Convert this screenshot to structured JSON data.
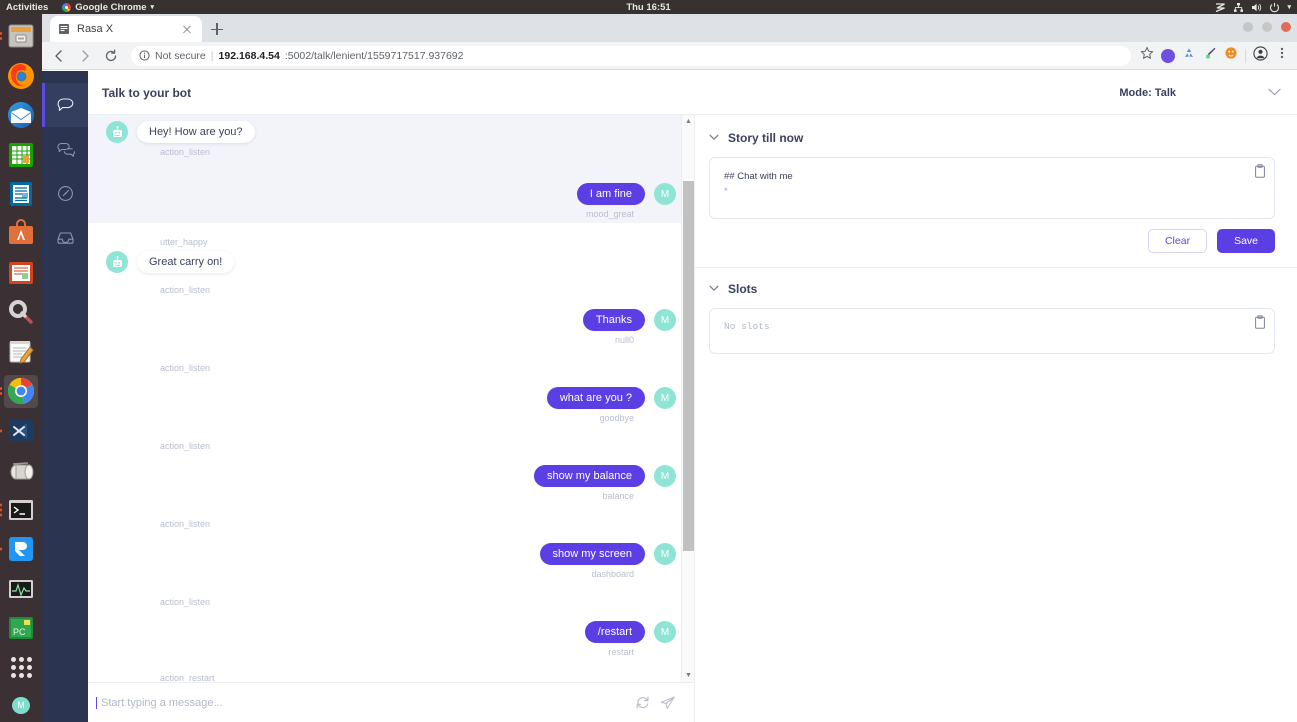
{
  "os": {
    "activities": "Activities",
    "app_menu": "Google Chrome",
    "clock": "Thu 16:51",
    "dock": [
      {
        "name": "files",
        "label": "Files"
      },
      {
        "name": "firefox",
        "label": "Firefox"
      },
      {
        "name": "thunderbird",
        "label": "Thunderbird"
      },
      {
        "name": "libreoffice-calc",
        "label": "LibreOffice Calc"
      },
      {
        "name": "libreoffice-writer",
        "label": "LibreOffice Writer"
      },
      {
        "name": "ubuntu-software",
        "label": "Ubuntu Software"
      },
      {
        "name": "libreoffice-impress",
        "label": "LibreOffice Impress"
      },
      {
        "name": "settings-tools",
        "label": "System Tools"
      },
      {
        "name": "text-editor",
        "label": "Text Editor"
      },
      {
        "name": "google-chrome",
        "label": "Google Chrome"
      },
      {
        "name": "vs-code",
        "label": "Visual Studio Code"
      },
      {
        "name": "archive-manager",
        "label": "Archive Manager"
      },
      {
        "name": "terminal",
        "label": "Terminal"
      },
      {
        "name": "rasa-app",
        "label": "Rasa"
      },
      {
        "name": "system-monitor",
        "label": "System Monitor"
      },
      {
        "name": "pycharm",
        "label": "PyCharm"
      }
    ],
    "user_initial": "M"
  },
  "browser": {
    "tab_title": "Rasa X",
    "not_secure": "Not secure",
    "url_host": "192.168.4.54",
    "url_path": ":5002/talk/lenient/1559717517.937692"
  },
  "app": {
    "title": "Talk to your bot",
    "mode_label": "Mode: Talk",
    "sidebar": [
      {
        "name": "chat",
        "icon": "chat-bubble-icon",
        "active": true
      },
      {
        "name": "conversations",
        "icon": "conversations-icon",
        "active": false
      },
      {
        "name": "models",
        "icon": "gauge-icon",
        "active": false
      },
      {
        "name": "inbox",
        "icon": "inbox-icon",
        "active": false
      }
    ]
  },
  "chat": {
    "bot_avatar_icon": "robot-icon",
    "user_initial": "M",
    "turns": [
      {
        "highlight": true,
        "bot_message": "Hey! How are you?",
        "bot_action": "action_listen",
        "user_message": "I am fine",
        "user_intent": "mood_great"
      },
      {
        "highlight": false,
        "bot_action_top": "utter_happy",
        "bot_message": "Great carry on!",
        "bot_action": "action_listen",
        "user_message": "Thanks",
        "user_intent": "null0"
      },
      {
        "highlight": false,
        "bot_action": "action_listen",
        "user_message": "what are you ?",
        "user_intent": "goodbye"
      },
      {
        "highlight": false,
        "bot_action": "action_listen",
        "user_message": "show my balance",
        "user_intent": "balance"
      },
      {
        "highlight": false,
        "bot_action": "action_listen",
        "user_message": "show my screen",
        "user_intent": "dashboard"
      },
      {
        "highlight": false,
        "bot_action": "action_listen",
        "user_message": "/restart",
        "user_intent": "restart"
      }
    ],
    "final_action": "action_restart",
    "typing_indicator": "•••",
    "composer_placeholder": "Start typing a message...",
    "restart_icon": "restart-icon",
    "send_icon": "send-icon"
  },
  "story_panel": {
    "title": "Story till now",
    "copy_icon": "clipboard-icon",
    "line1": "## Chat with me",
    "line2": "*",
    "clear_label": "Clear",
    "save_label": "Save"
  },
  "slots_panel": {
    "title": "Slots",
    "copy_icon": "clipboard-icon",
    "empty_text": "No slots"
  },
  "colors": {
    "accent_purple": "#5b3fe4",
    "bot_teal": "#8fe5d5",
    "sidebar_navy": "#2b3552",
    "text_navy": "#3b4160",
    "meta_gray": "#b9bece"
  }
}
